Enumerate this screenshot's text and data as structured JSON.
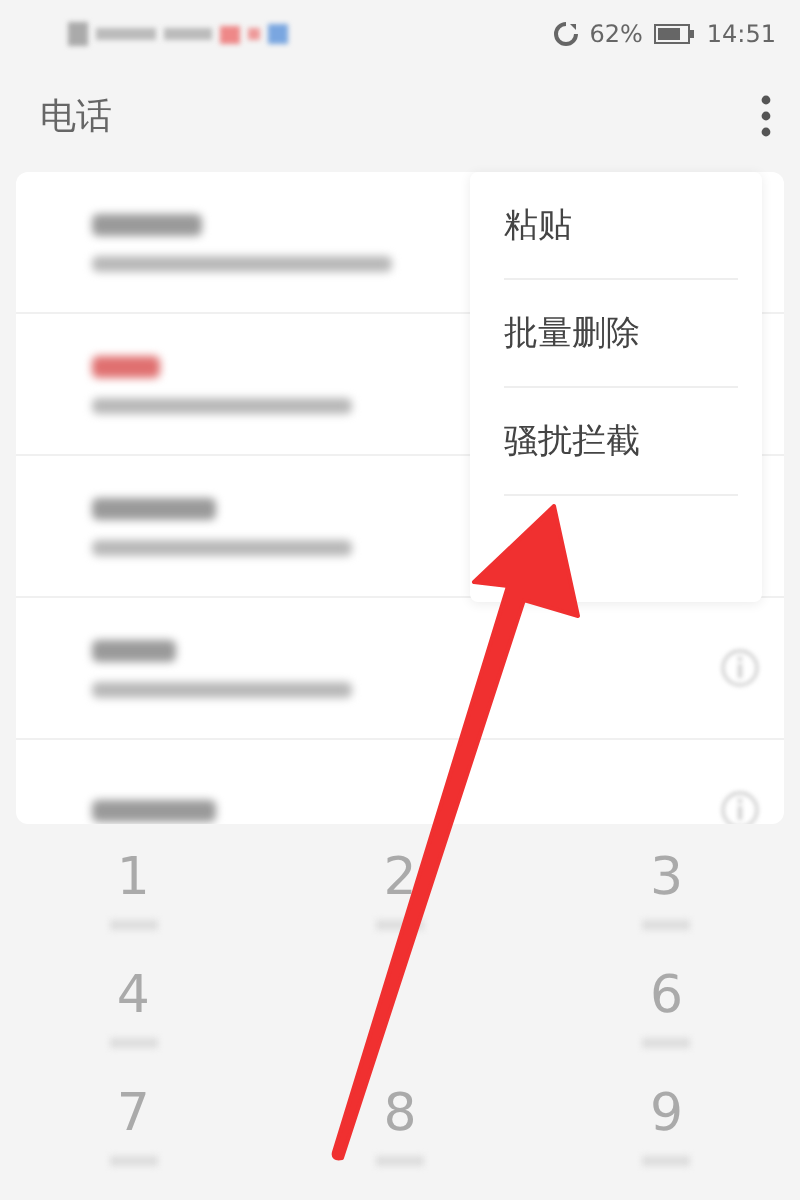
{
  "status_bar": {
    "battery_percent": "62%",
    "time": "14:51"
  },
  "app_bar": {
    "title": "电话"
  },
  "calls": [
    {
      "kind": "full",
      "missed": false,
      "info": false
    },
    {
      "kind": "full",
      "missed": true,
      "info": false
    },
    {
      "kind": "full",
      "missed": false,
      "info": false
    },
    {
      "kind": "full",
      "missed": false,
      "info": true
    },
    {
      "kind": "cut",
      "missed": false,
      "info": true
    }
  ],
  "menu": {
    "items": [
      "粘贴",
      "批量删除",
      "骚扰拦截"
    ]
  },
  "keypad": {
    "keys": [
      {
        "kind": "digit",
        "label": "1"
      },
      {
        "kind": "digit",
        "label": "2"
      },
      {
        "kind": "digit",
        "label": "3"
      },
      {
        "kind": "digit",
        "label": "4"
      },
      {
        "kind": "covered"
      },
      {
        "kind": "digit",
        "label": "6"
      },
      {
        "kind": "digit",
        "label": "7"
      },
      {
        "kind": "digit",
        "label": "8"
      },
      {
        "kind": "digit",
        "label": "9"
      }
    ]
  }
}
